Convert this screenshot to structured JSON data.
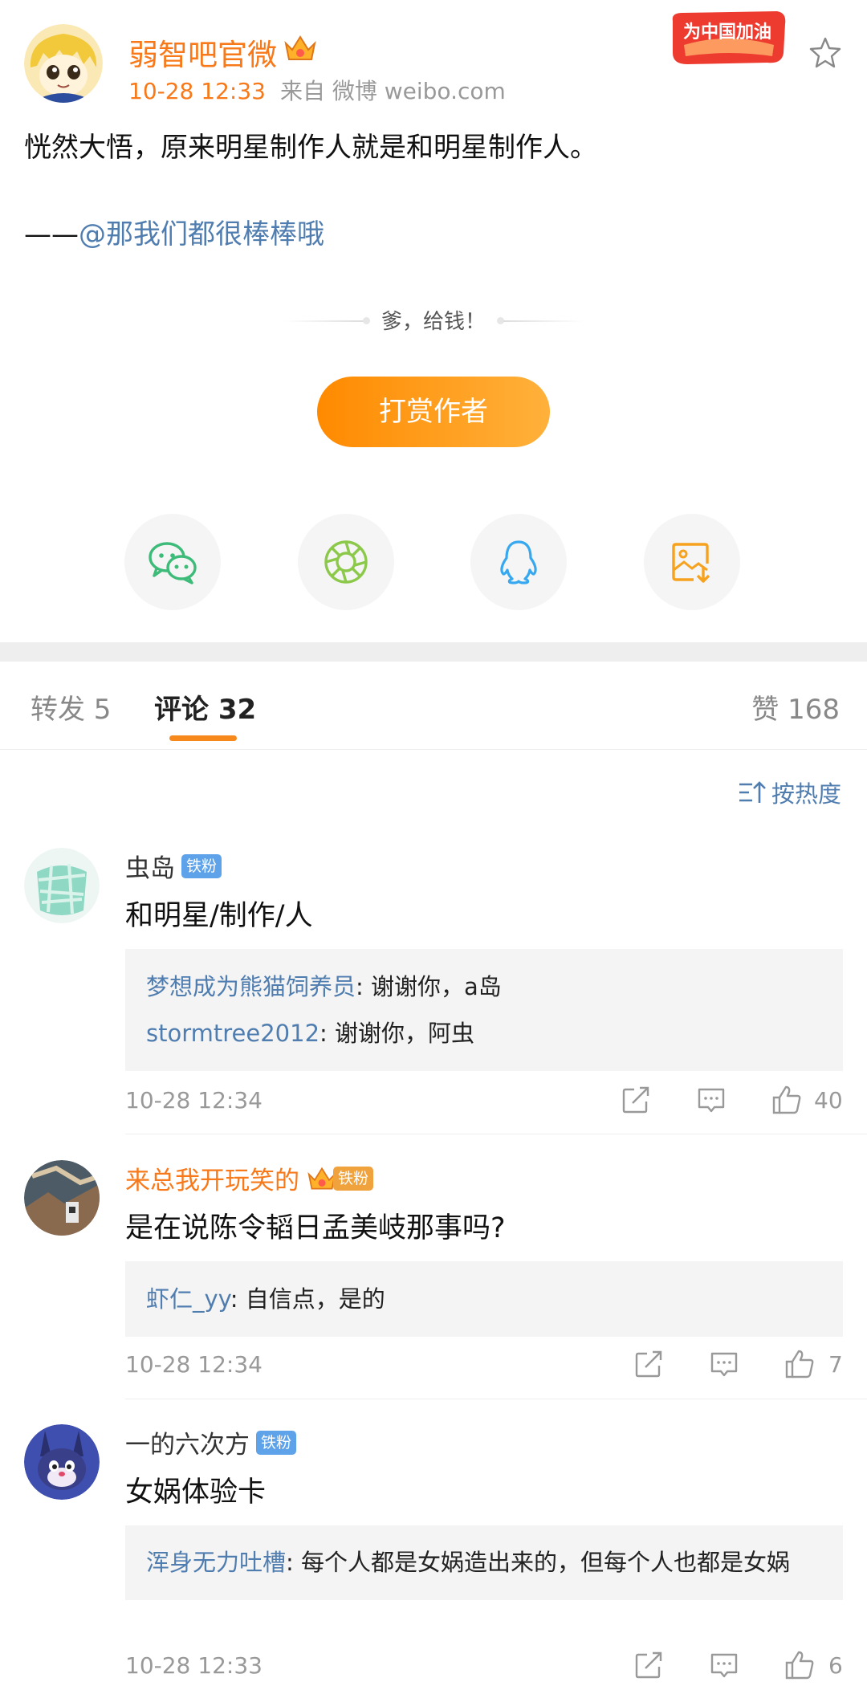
{
  "post": {
    "author": "弱智吧官微",
    "time": "10-28 12:33",
    "source": "来自 微博 weibo.com",
    "badge_text": "为中国加油",
    "body_line1": "恍然大悟，原来明星制作人就是和明星制作人。",
    "body_prefix": "——",
    "body_mention": "@那我们都很棒棒哦"
  },
  "reward": {
    "tip": "爹，给钱！",
    "button": "打赏作者"
  },
  "share": {
    "icons": [
      "wechat-icon",
      "moments-icon",
      "qq-icon",
      "save-image-icon"
    ],
    "colors": {
      "wechat": "#3dbb78",
      "moments": "#8cc94a",
      "qq": "#36a8f0",
      "save": "#f7a21e"
    }
  },
  "tabs": {
    "repost": "转发 5",
    "comments": "评论 32",
    "likes": "赞 168"
  },
  "sort": {
    "label": "按热度"
  },
  "colors": {
    "accent_orange": "#f7791a",
    "link_blue": "#507daf",
    "fan_tag_blue": "#5ea3ea"
  },
  "comments": [
    {
      "name": "虫岛",
      "tag": "铁粉",
      "text": "和明星/制作/人",
      "replies": [
        {
          "user": "梦想成为熊猫饲养员",
          "text": ": 谢谢你，a岛"
        },
        {
          "user": "stormtree2012",
          "text": ": 谢谢你，阿虫"
        }
      ],
      "time": "10-28 12:34",
      "likes": "40"
    },
    {
      "name": "来总我开玩笑的",
      "tag": "铁粉",
      "text": "是在说陈令韬日孟美岐那事吗?",
      "replies": [
        {
          "user": "虾仁_yy",
          "text": ": 自信点，是的"
        }
      ],
      "time": "10-28 12:34",
      "likes": "7"
    },
    {
      "name": "一的六次方",
      "tag": "铁粉",
      "text": "女娲体验卡",
      "replies": [
        {
          "user": "浑身无力吐槽",
          "text": ": 每个人都是女娲造出来的，但每个人也都是女娲"
        }
      ],
      "time": "10-28 12:33",
      "likes": "6"
    }
  ]
}
